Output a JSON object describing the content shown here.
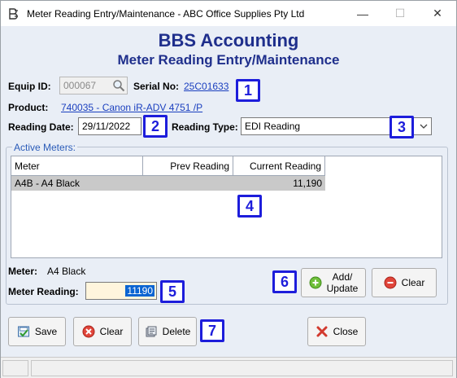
{
  "window": {
    "title": "Meter Reading Entry/Maintenance - ABC Office Supplies Pty Ltd",
    "minimize": "—",
    "maximize": "☐",
    "close": "✕"
  },
  "header": {
    "app_name": "BBS Accounting",
    "form_title": "Meter Reading Entry/Maintenance"
  },
  "form": {
    "equip_id_label": "Equip ID:",
    "equip_id_value": "000067",
    "serial_label": "Serial No:",
    "serial_value": "25C01633",
    "product_label": "Product:",
    "product_value": "740035 - Canon iR-ADV 4751 /P",
    "reading_date_label": "Reading Date:",
    "reading_date_value": "29/11/2022",
    "reading_type_label": "Reading Type:",
    "reading_type_value": "EDI Reading"
  },
  "meters": {
    "group_label": "Active Meters:",
    "columns": [
      "Meter",
      "Prev Reading",
      "Current Reading"
    ],
    "rows": [
      {
        "meter": "A4B - A4 Black",
        "prev": "",
        "current": "11,190"
      }
    ],
    "meter_label": "Meter:",
    "meter_value": "A4 Black",
    "meter_reading_label": "Meter Reading:",
    "meter_reading_value": "11190",
    "add_update_line1": "Add/",
    "add_update_line2": "Update",
    "clear_label": "Clear"
  },
  "footer": {
    "save_label": "Save",
    "clear_label": "Clear",
    "delete_label": "Delete",
    "close_label": "Close"
  },
  "badges": [
    "1",
    "2",
    "3",
    "4",
    "5",
    "6",
    "7"
  ],
  "colors": {
    "heading": "#1f2f8c",
    "link": "#1a3fbf",
    "badge_border": "#1d1ddb",
    "selected_row": "#c9c9c9",
    "reading_field_bg": "#fff5dd",
    "selection": "#0a64d2",
    "legend": "#2a5bb8"
  }
}
